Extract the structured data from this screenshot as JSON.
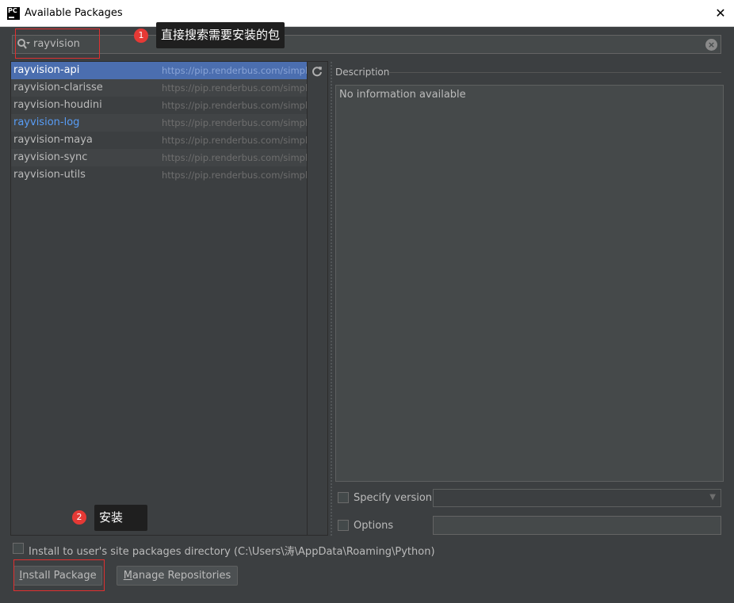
{
  "window": {
    "title": "Available Packages",
    "app_icon_text": "PC",
    "close_glyph": "✕"
  },
  "search": {
    "value": "rayvision",
    "clear_glyph": "×"
  },
  "packages": [
    {
      "name": "rayvision-api",
      "repo": "https://pip.renderbus.com/simple/",
      "selected": true,
      "installed": false
    },
    {
      "name": "rayvision-clarisse",
      "repo": "https://pip.renderbus.com/simple/",
      "selected": false,
      "installed": false
    },
    {
      "name": "rayvision-houdini",
      "repo": "https://pip.renderbus.com/simple/",
      "selected": false,
      "installed": false
    },
    {
      "name": "rayvision-log",
      "repo": "https://pip.renderbus.com/simple/",
      "selected": false,
      "installed": true
    },
    {
      "name": "rayvision-maya",
      "repo": "https://pip.renderbus.com/simple/",
      "selected": false,
      "installed": false
    },
    {
      "name": "rayvision-sync",
      "repo": "https://pip.renderbus.com/simple/",
      "selected": false,
      "installed": false
    },
    {
      "name": "rayvision-utils",
      "repo": "https://pip.renderbus.com/simple/",
      "selected": false,
      "installed": false
    }
  ],
  "description": {
    "label": "Description",
    "text": "No information available"
  },
  "specify_version": {
    "label": "Specify version",
    "checked": false,
    "selected_value": ""
  },
  "options": {
    "label": "Options",
    "checked": false,
    "value": ""
  },
  "install_user_site": {
    "label": "Install to user's site packages directory (C:\\Users\\涛\\AppData\\Roaming\\Python)",
    "checked": false
  },
  "buttons": {
    "install": {
      "mnemonic": "I",
      "rest": "nstall Package"
    },
    "manage": {
      "mnemonic": "M",
      "rest": "anage Repositories"
    }
  },
  "annotations": [
    {
      "number": "1",
      "text": "直接搜索需要安装的包"
    },
    {
      "number": "2",
      "text": "安装"
    }
  ],
  "colors": {
    "background": "#3c3f41",
    "selection": "#4b6eaf",
    "installed_text": "#589df6",
    "annotation_red": "#e53935"
  }
}
